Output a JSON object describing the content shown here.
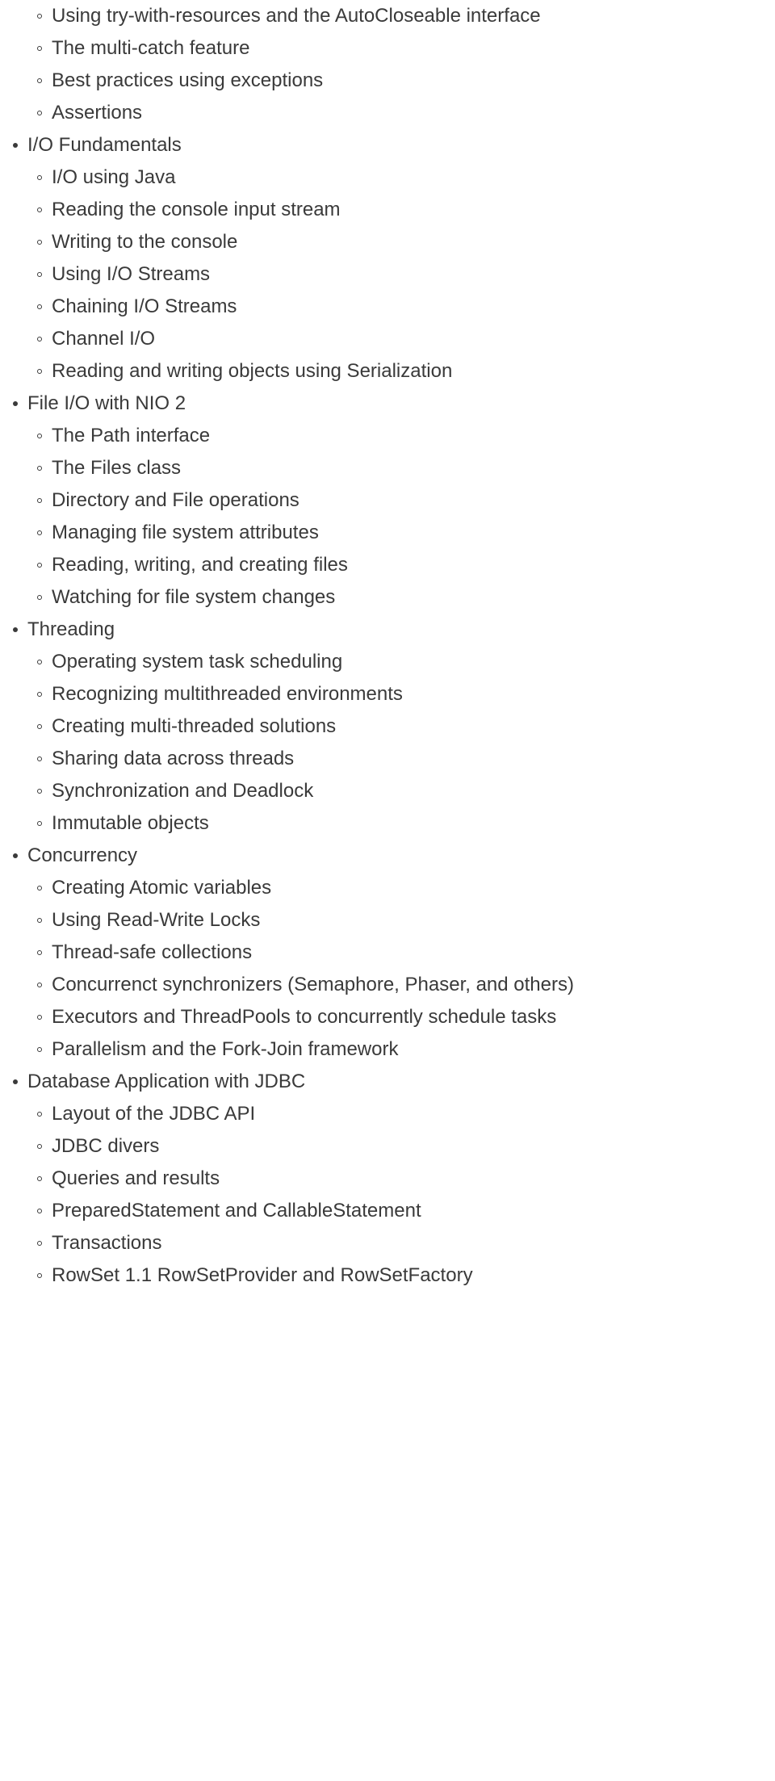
{
  "outline": [
    {
      "label": null,
      "children": [
        "Using try-with-resources and the AutoCloseable interface",
        "The multi-catch feature",
        "Best practices using exceptions",
        "Assertions"
      ]
    },
    {
      "label": "I/O Fundamentals",
      "children": [
        "I/O using Java",
        "Reading the console input stream",
        "Writing to the console",
        "Using I/O Streams",
        "Chaining I/O Streams",
        "Channel I/O",
        "Reading and writing objects using Serialization"
      ]
    },
    {
      "label": "File I/O with NIO 2",
      "children": [
        "The Path interface",
        "The Files class",
        "Directory and File operations",
        "Managing file system attributes",
        "Reading, writing, and creating files",
        "Watching for file system changes"
      ]
    },
    {
      "label": "Threading",
      "children": [
        "Operating system task scheduling",
        "Recognizing multithreaded environments",
        "Creating multi-threaded solutions",
        "Sharing data across threads",
        "Synchronization and Deadlock",
        "Immutable objects"
      ]
    },
    {
      "label": "Concurrency",
      "children": [
        "Creating Atomic variables",
        "Using Read-Write Locks",
        "Thread-safe collections",
        "Concurrenct synchronizers (Semaphore, Phaser, and others)",
        "Executors and ThreadPools to concurrently schedule tasks",
        "Parallelism and the Fork-Join framework"
      ]
    },
    {
      "label": "Database Application with JDBC",
      "children": [
        "Layout of the JDBC API",
        "JDBC divers",
        "Queries and results",
        "PreparedStatement and CallableStatement",
        "Transactions",
        "RowSet 1.1 RowSetProvider and RowSetFactory"
      ]
    }
  ]
}
